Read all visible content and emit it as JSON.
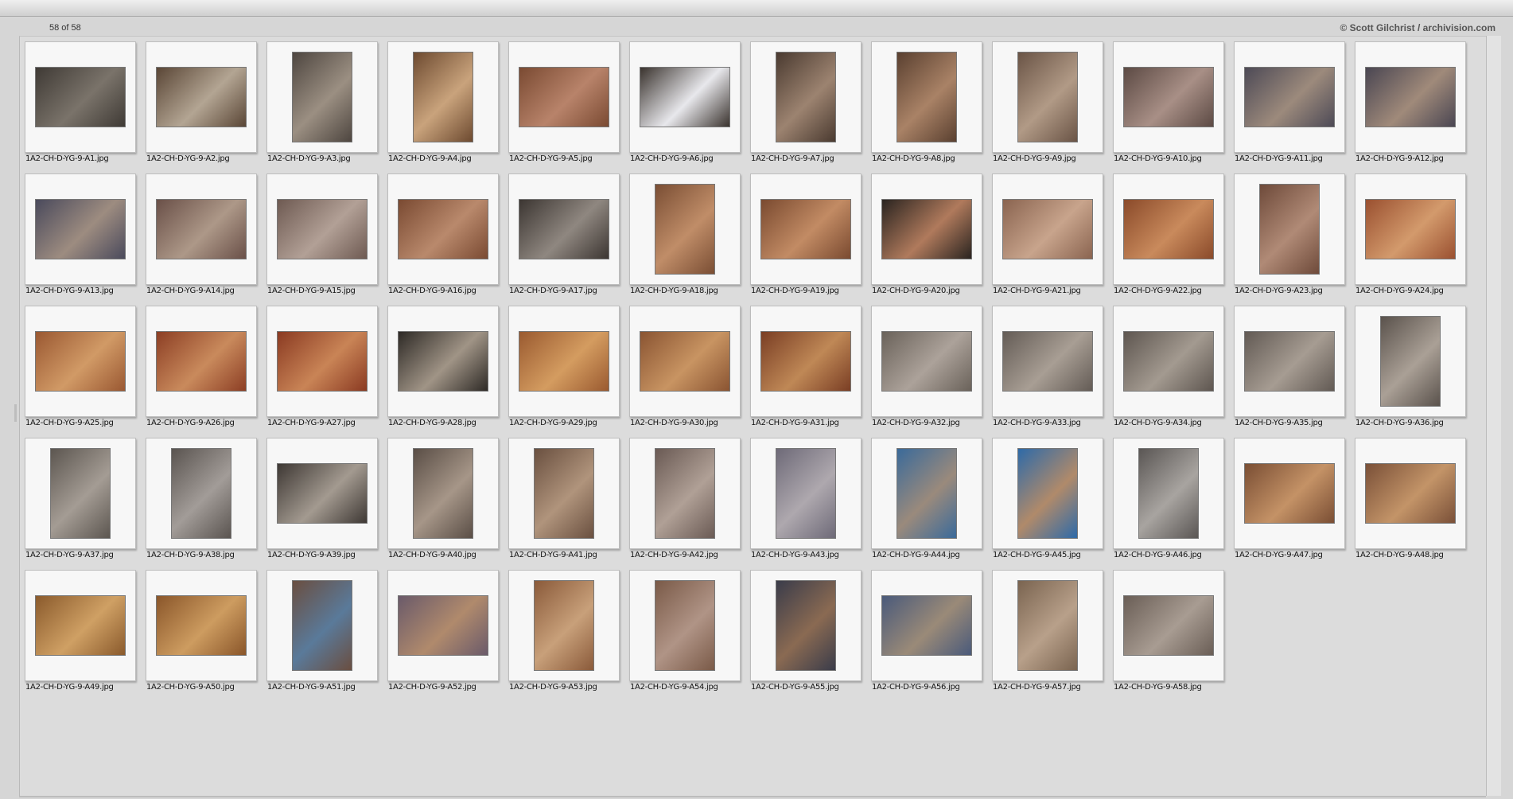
{
  "header": {
    "count_label": "58 of 58",
    "copyright": "© Scott Gilchrist / archivision.com"
  },
  "images": [
    {
      "name": "1A2-CH-D-YG-9-A1.jpg",
      "orientation": "landscape",
      "colors": [
        "#3f3a35",
        "#7a736a"
      ]
    },
    {
      "name": "1A2-CH-D-YG-9-A2.jpg",
      "orientation": "landscape",
      "colors": [
        "#5a4636",
        "#b3a593"
      ]
    },
    {
      "name": "1A2-CH-D-YG-9-A3.jpg",
      "orientation": "portrait",
      "colors": [
        "#4e4640",
        "#9b8f82"
      ]
    },
    {
      "name": "1A2-CH-D-YG-9-A4.jpg",
      "orientation": "portrait",
      "colors": [
        "#6d4a30",
        "#c9a37c"
      ]
    },
    {
      "name": "1A2-CH-D-YG-9-A5.jpg",
      "orientation": "landscape",
      "colors": [
        "#7a4a32",
        "#b8836a"
      ]
    },
    {
      "name": "1A2-CH-D-YG-9-A6.jpg",
      "orientation": "landscape",
      "colors": [
        "#3a332e",
        "#e8e8ec"
      ]
    },
    {
      "name": "1A2-CH-D-YG-9-A7.jpg",
      "orientation": "portrait",
      "colors": [
        "#4a3a30",
        "#9c8370"
      ]
    },
    {
      "name": "1A2-CH-D-YG-9-A8.jpg",
      "orientation": "portrait",
      "colors": [
        "#5a4030",
        "#a98266"
      ]
    },
    {
      "name": "1A2-CH-D-YG-9-A9.jpg",
      "orientation": "portrait",
      "colors": [
        "#6a5446",
        "#b19a86"
      ]
    },
    {
      "name": "1A2-CH-D-YG-9-A10.jpg",
      "orientation": "landscape",
      "colors": [
        "#5c4a44",
        "#a88f86"
      ]
    },
    {
      "name": "1A2-CH-D-YG-9-A11.jpg",
      "orientation": "landscape",
      "colors": [
        "#4d4a56",
        "#9c8a7c"
      ]
    },
    {
      "name": "1A2-CH-D-YG-9-A12.jpg",
      "orientation": "landscape",
      "colors": [
        "#4a4652",
        "#a08a7a"
      ]
    },
    {
      "name": "1A2-CH-D-YG-9-A13.jpg",
      "orientation": "landscape",
      "colors": [
        "#4a4a5c",
        "#9d8c80"
      ]
    },
    {
      "name": "1A2-CH-D-YG-9-A14.jpg",
      "orientation": "landscape",
      "colors": [
        "#6a5048",
        "#ad9888"
      ]
    },
    {
      "name": "1A2-CH-D-YG-9-A15.jpg",
      "orientation": "landscape",
      "colors": [
        "#6e5a52",
        "#b2a096"
      ]
    },
    {
      "name": "1A2-CH-D-YG-9-A16.jpg",
      "orientation": "landscape",
      "colors": [
        "#7a4a32",
        "#b9896c"
      ]
    },
    {
      "name": "1A2-CH-D-YG-9-A17.jpg",
      "orientation": "landscape",
      "colors": [
        "#3c3632",
        "#8f8780"
      ]
    },
    {
      "name": "1A2-CH-D-YG-9-A18.jpg",
      "orientation": "portrait",
      "colors": [
        "#7a4e34",
        "#c08d68"
      ]
    },
    {
      "name": "1A2-CH-D-YG-9-A19.jpg",
      "orientation": "landscape",
      "colors": [
        "#7a4a30",
        "#c28b64"
      ]
    },
    {
      "name": "1A2-CH-D-YG-9-A20.jpg",
      "orientation": "landscape",
      "colors": [
        "#2a2420",
        "#b07a5c"
      ]
    },
    {
      "name": "1A2-CH-D-YG-9-A21.jpg",
      "orientation": "landscape",
      "colors": [
        "#8a6450",
        "#c8a48c"
      ]
    },
    {
      "name": "1A2-CH-D-YG-9-A22.jpg",
      "orientation": "landscape",
      "colors": [
        "#8a4a2a",
        "#c98a5c"
      ]
    },
    {
      "name": "1A2-CH-D-YG-9-A23.jpg",
      "orientation": "portrait",
      "colors": [
        "#6e4a3a",
        "#b08a76"
      ]
    },
    {
      "name": "1A2-CH-D-YG-9-A24.jpg",
      "orientation": "landscape",
      "colors": [
        "#9a5030",
        "#d39a6c"
      ]
    },
    {
      "name": "1A2-CH-D-YG-9-A25.jpg",
      "orientation": "landscape",
      "colors": [
        "#9a5832",
        "#d19a66"
      ]
    },
    {
      "name": "1A2-CH-D-YG-9-A26.jpg",
      "orientation": "landscape",
      "colors": [
        "#8c3e24",
        "#c98a5c"
      ]
    },
    {
      "name": "1A2-CH-D-YG-9-A27.jpg",
      "orientation": "landscape",
      "colors": [
        "#8a3a22",
        "#c98456"
      ]
    },
    {
      "name": "1A2-CH-D-YG-9-A28.jpg",
      "orientation": "landscape",
      "colors": [
        "#2e2a26",
        "#a09486"
      ]
    },
    {
      "name": "1A2-CH-D-YG-9-A29.jpg",
      "orientation": "landscape",
      "colors": [
        "#9a5a30",
        "#d49c60"
      ]
    },
    {
      "name": "1A2-CH-D-YG-9-A30.jpg",
      "orientation": "landscape",
      "colors": [
        "#8a5432",
        "#c89462"
      ]
    },
    {
      "name": "1A2-CH-D-YG-9-A31.jpg",
      "orientation": "landscape",
      "colors": [
        "#7a3e24",
        "#bf8856"
      ]
    },
    {
      "name": "1A2-CH-D-YG-9-A32.jpg",
      "orientation": "landscape",
      "colors": [
        "#6a625a",
        "#aca29a"
      ]
    },
    {
      "name": "1A2-CH-D-YG-9-A33.jpg",
      "orientation": "landscape",
      "colors": [
        "#645c56",
        "#a89e94"
      ]
    },
    {
      "name": "1A2-CH-D-YG-9-A34.jpg",
      "orientation": "landscape",
      "colors": [
        "#5e5650",
        "#a39a90"
      ]
    },
    {
      "name": "1A2-CH-D-YG-9-A35.jpg",
      "orientation": "landscape",
      "colors": [
        "#625a54",
        "#a69c92"
      ]
    },
    {
      "name": "1A2-CH-D-YG-9-A36.jpg",
      "orientation": "portrait",
      "colors": [
        "#5a524c",
        "#aaa096"
      ]
    },
    {
      "name": "1A2-CH-D-YG-9-A37.jpg",
      "orientation": "portrait",
      "colors": [
        "#5c5650",
        "#a49c94"
      ]
    },
    {
      "name": "1A2-CH-D-YG-9-A38.jpg",
      "orientation": "portrait",
      "colors": [
        "#5a5450",
        "#a29c98"
      ]
    },
    {
      "name": "1A2-CH-D-YG-9-A39.jpg",
      "orientation": "landscape",
      "colors": [
        "#3e3834",
        "#a39a90"
      ]
    },
    {
      "name": "1A2-CH-D-YG-9-A40.jpg",
      "orientation": "portrait",
      "colors": [
        "#5a4e46",
        "#a69688"
      ]
    },
    {
      "name": "1A2-CH-D-YG-9-A41.jpg",
      "orientation": "portrait",
      "colors": [
        "#6a5040",
        "#b0947c"
      ]
    },
    {
      "name": "1A2-CH-D-YG-9-A42.jpg",
      "orientation": "portrait",
      "colors": [
        "#6a5a54",
        "#b0a096"
      ]
    },
    {
      "name": "1A2-CH-D-YG-9-A43.jpg",
      "orientation": "portrait",
      "colors": [
        "#6e6a78",
        "#aea8ae"
      ]
    },
    {
      "name": "1A2-CH-D-YG-9-A44.jpg",
      "orientation": "portrait",
      "colors": [
        "#3a6a9a",
        "#9a8a7c"
      ]
    },
    {
      "name": "1A2-CH-D-YG-9-A45.jpg",
      "orientation": "portrait",
      "colors": [
        "#2e6aa8",
        "#b08a6a"
      ]
    },
    {
      "name": "1A2-CH-D-YG-9-A46.jpg",
      "orientation": "portrait",
      "colors": [
        "#5a5654",
        "#a8a4a0"
      ]
    },
    {
      "name": "1A2-CH-D-YG-9-A47.jpg",
      "orientation": "landscape",
      "colors": [
        "#7a4e34",
        "#c49266"
      ]
    },
    {
      "name": "1A2-CH-D-YG-9-A48.jpg",
      "orientation": "landscape",
      "colors": [
        "#7a5038",
        "#c39468"
      ]
    },
    {
      "name": "1A2-CH-D-YG-9-A49.jpg",
      "orientation": "landscape",
      "colors": [
        "#8a5a2c",
        "#cfa064"
      ]
    },
    {
      "name": "1A2-CH-D-YG-9-A50.jpg",
      "orientation": "landscape",
      "colors": [
        "#8a562a",
        "#cd9c60"
      ]
    },
    {
      "name": "1A2-CH-D-YG-9-A51.jpg",
      "orientation": "portrait",
      "colors": [
        "#6a4e40",
        "#5a7a9a"
      ]
    },
    {
      "name": "1A2-CH-D-YG-9-A52.jpg",
      "orientation": "landscape",
      "colors": [
        "#6a5a6a",
        "#b08a6c"
      ]
    },
    {
      "name": "1A2-CH-D-YG-9-A53.jpg",
      "orientation": "portrait",
      "colors": [
        "#8a5a3a",
        "#c8a07a"
      ]
    },
    {
      "name": "1A2-CH-D-YG-9-A54.jpg",
      "orientation": "portrait",
      "colors": [
        "#7a5a48",
        "#b09486"
      ]
    },
    {
      "name": "1A2-CH-D-YG-9-A55.jpg",
      "orientation": "portrait",
      "colors": [
        "#3a3c4a",
        "#8a6a52"
      ]
    },
    {
      "name": "1A2-CH-D-YG-9-A56.jpg",
      "orientation": "landscape",
      "colors": [
        "#4a5a7a",
        "#9a8a78"
      ]
    },
    {
      "name": "1A2-CH-D-YG-9-A57.jpg",
      "orientation": "portrait",
      "colors": [
        "#7a6450",
        "#b8a08a"
      ]
    },
    {
      "name": "1A2-CH-D-YG-9-A58.jpg",
      "orientation": "landscape",
      "colors": [
        "#6a5e56",
        "#a89c92"
      ]
    }
  ]
}
